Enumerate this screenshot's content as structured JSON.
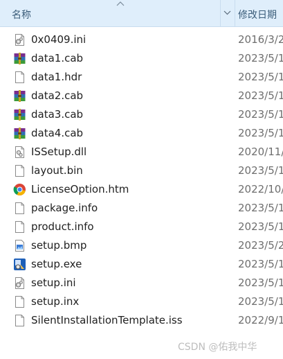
{
  "header": {
    "name_label": "名称",
    "date_label": "修改日期"
  },
  "files": [
    {
      "name": "0x0409.ini",
      "date": "2016/3/2",
      "icon": "ini-settings-icon"
    },
    {
      "name": "data1.cab",
      "date": "2023/5/1",
      "icon": "winrar-archive-icon"
    },
    {
      "name": "data1.hdr",
      "date": "2023/5/1",
      "icon": "blank-file-icon"
    },
    {
      "name": "data2.cab",
      "date": "2023/5/1",
      "icon": "winrar-archive-icon"
    },
    {
      "name": "data3.cab",
      "date": "2023/5/1",
      "icon": "winrar-archive-icon"
    },
    {
      "name": "data4.cab",
      "date": "2023/5/1",
      "icon": "winrar-archive-icon"
    },
    {
      "name": "ISSetup.dll",
      "date": "2020/11/",
      "icon": "dll-file-icon"
    },
    {
      "name": "layout.bin",
      "date": "2023/5/1",
      "icon": "blank-file-icon"
    },
    {
      "name": "LicenseOption.htm",
      "date": "2022/10/",
      "icon": "chrome-icon"
    },
    {
      "name": "package.info",
      "date": "2023/5/1",
      "icon": "blank-file-icon"
    },
    {
      "name": "product.info",
      "date": "2023/5/1",
      "icon": "blank-file-icon"
    },
    {
      "name": "setup.bmp",
      "date": "2023/5/2",
      "icon": "bitmap-image-icon"
    },
    {
      "name": "setup.exe",
      "date": "2023/5/1",
      "icon": "installer-exe-icon"
    },
    {
      "name": "setup.ini",
      "date": "2023/5/1",
      "icon": "ini-settings-icon"
    },
    {
      "name": "setup.inx",
      "date": "2023/5/1",
      "icon": "blank-file-icon"
    },
    {
      "name": "SilentInstallationTemplate.iss",
      "date": "2022/9/1",
      "icon": "blank-file-icon"
    }
  ],
  "watermark": "CSDN @佑我中华"
}
